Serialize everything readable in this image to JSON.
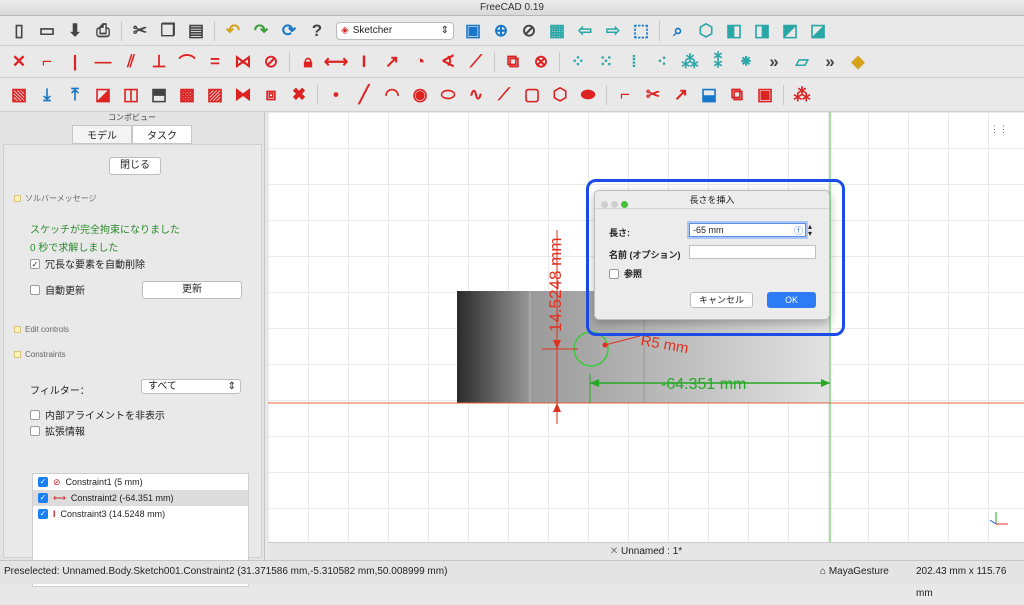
{
  "app": {
    "title": "FreeCAD 0.19"
  },
  "toolbar": {
    "workbench": "Sketcher",
    "row1": [
      "new-file",
      "open-file",
      "save",
      "print",
      "cut",
      "copy",
      "paste",
      "undo",
      "redo",
      "refresh",
      "whats-this",
      "workbench-select",
      "std-view-fit-all",
      "fit-selection",
      "draw-style",
      "bounding-box",
      "back",
      "forward",
      "link",
      "zoom",
      "axonometric",
      "front",
      "top",
      "right"
    ],
    "row2": [
      "sketcher-point",
      "arc",
      "line",
      "horizontal",
      "vertical",
      "parallel",
      "perpendicular",
      "equal",
      "symmetric",
      "block",
      "lock",
      "horizontal-distance",
      "vertical-distance",
      "distance",
      "radius",
      "angle",
      "snell",
      "fix",
      "select-constraints",
      "select-elements"
    ],
    "row3": [
      "new-sketch",
      "leave-sketch",
      "view-sketch",
      "view-section",
      "map-sketch",
      "reorient",
      "validate",
      "merge",
      "mirror",
      "delete-all",
      "point",
      "line-tool",
      "arc-tool",
      "circle",
      "conic",
      "bspline",
      "polyline",
      "rectangle",
      "polygon",
      "slot",
      "fillet",
      "trim",
      "extend",
      "external",
      "carbon",
      "toggle-construction"
    ]
  },
  "panel": {
    "header": "コンポビュー",
    "tabs": [
      "モデル",
      "タスク"
    ],
    "close_btn": "閉じる",
    "solver_section": "ソルバーメッセージ",
    "solver_msg1": "スケッチが完全拘束になりました",
    "solver_msg2": "0 秒で求解しました",
    "auto_remove": "冗長な要素を自動削除",
    "auto_update": "自動更新",
    "update_btn": "更新",
    "edit_controls": "Edit controls",
    "constraints_section": "Constraints",
    "filter_label": "フィルター：",
    "filter_value": "すべて",
    "hide_internal": "内部アライメントを非表示",
    "extended_info": "拡張情報",
    "constraints": [
      {
        "label": "Constraint1 (5 mm)"
      },
      {
        "label": "Constraint2 (-64.351 mm)"
      },
      {
        "label": "Constraint3 (14.5248 mm)"
      }
    ]
  },
  "canvas": {
    "dim_vertical": "14.5248 mm",
    "dim_radius": "R5 mm",
    "dim_horizontal": "-64.351 mm"
  },
  "dialog": {
    "title": "長さを挿入",
    "length_label": "長さ:",
    "length_value": "-65",
    "length_unit": "mm",
    "name_label": "名前 (オプション)",
    "name_value": "",
    "reference_label": "参照",
    "cancel": "キャンセル",
    "ok": "OK"
  },
  "docbar": {
    "tab": "Unnamed : 1*"
  },
  "status": {
    "preselected": "Preselected: Unnamed.Body.Sketch001.Constraint2 (31.371586 mm,-5.310582 mm,50.008999 mm)",
    "nav_style": "MayaGesture",
    "dimensions": "202.43 mm x 115.76 mm"
  },
  "colors": {
    "accent": "#1a4de8",
    "constraint": "#e03020",
    "sketch": "#33aa33"
  }
}
